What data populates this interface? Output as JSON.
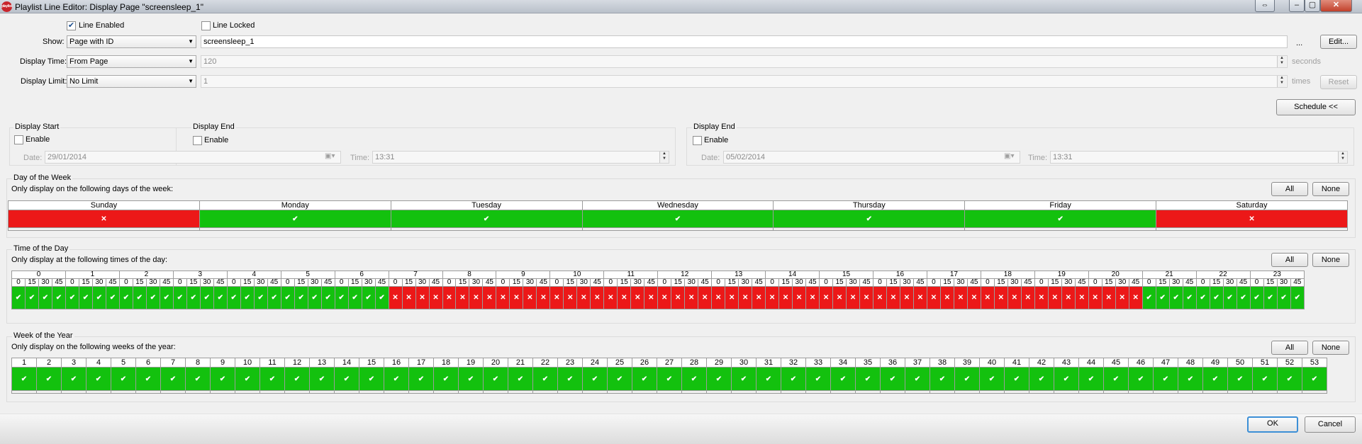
{
  "window": {
    "title": "Playlist Line Editor: Display Page \"screensleep_1\"",
    "app_icon_text": "playlist",
    "controls": [
      "restore",
      "minimize",
      "maximize",
      "close"
    ]
  },
  "line_enabled": {
    "label": "Line Enabled",
    "checked": true
  },
  "line_locked": {
    "label": "Line Locked",
    "checked": false
  },
  "show": {
    "label": "Show:",
    "value": "Page with ID",
    "field": "screensleep_1",
    "ellipsis": "...",
    "edit_button": "Edit..."
  },
  "display_time": {
    "label": "Display Time:",
    "value": "From Page",
    "field": "120",
    "unit": "seconds"
  },
  "display_limit": {
    "label": "Display Limit:",
    "value": "No Limit",
    "field": "1",
    "unit": "times",
    "reset_button": "Reset"
  },
  "schedule_button": "Schedule <<",
  "display_start": {
    "title": "Display Start",
    "enable_label": "Enable",
    "enabled": false,
    "date_label": "Date:",
    "date": "29/01/2014",
    "time_label": "Time:",
    "time": "13:31"
  },
  "display_end_overlap": {
    "title": "Display End",
    "enable_label": "Enable",
    "enabled": false
  },
  "display_end": {
    "title": "Display End",
    "enable_label": "Enable",
    "enabled": false,
    "date_label": "Date:",
    "date": "05/02/2014",
    "time_label": "Time:",
    "time": "13:31"
  },
  "day_of_week": {
    "title": "Day of the Week",
    "subtitle": "Only display on the following days of the week:",
    "all_button": "All",
    "none_button": "None",
    "days": [
      {
        "name": "Sunday",
        "on": false
      },
      {
        "name": "Monday",
        "on": true
      },
      {
        "name": "Tuesday",
        "on": true
      },
      {
        "name": "Wednesday",
        "on": true
      },
      {
        "name": "Thursday",
        "on": true
      },
      {
        "name": "Friday",
        "on": true
      },
      {
        "name": "Saturday",
        "on": false
      }
    ]
  },
  "time_of_day": {
    "title": "Time of the Day",
    "subtitle": "Only display at the following times of the day:",
    "all_button": "All",
    "none_button": "None",
    "hours": [
      "0",
      "1",
      "2",
      "3",
      "4",
      "5",
      "6",
      "7",
      "8",
      "9",
      "10",
      "11",
      "12",
      "13",
      "14",
      "15",
      "16",
      "17",
      "18",
      "19",
      "20",
      "21",
      "22",
      "23"
    ],
    "quarters": [
      "0",
      "15",
      "30",
      "45"
    ],
    "enabled_hours": [
      true,
      true,
      true,
      true,
      true,
      true,
      true,
      false,
      false,
      false,
      false,
      false,
      false,
      false,
      false,
      false,
      false,
      false,
      false,
      false,
      false,
      true,
      true,
      true
    ]
  },
  "week_of_year": {
    "title": "Week of the Year",
    "subtitle": "Only display on the following weeks of the year:",
    "all_button": "All",
    "none_button": "None",
    "weeks": [
      "1",
      "2",
      "3",
      "4",
      "5",
      "6",
      "7",
      "8",
      "9",
      "10",
      "11",
      "12",
      "13",
      "14",
      "15",
      "16",
      "17",
      "18",
      "19",
      "20",
      "21",
      "22",
      "23",
      "24",
      "25",
      "26",
      "27",
      "28",
      "29",
      "30",
      "31",
      "32",
      "33",
      "34",
      "35",
      "36",
      "37",
      "38",
      "39",
      "40",
      "41",
      "42",
      "43",
      "44",
      "45",
      "46",
      "47",
      "48",
      "49",
      "50",
      "51",
      "52",
      "53"
    ],
    "all_on": true
  },
  "symbols": {
    "on": "✔",
    "off": "✕"
  },
  "colors": {
    "on": "#13c10e",
    "off": "#ec1818"
  },
  "footer": {
    "ok_button": "OK",
    "cancel_button": "Cancel"
  }
}
